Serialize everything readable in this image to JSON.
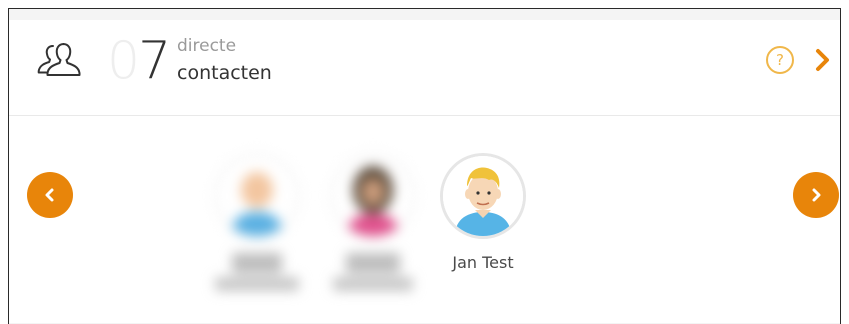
{
  "header": {
    "count_dim": "0",
    "count_main": "7",
    "label_line1": "directe",
    "label_line2": "contacten",
    "help_symbol": "?"
  },
  "colors": {
    "accent": "#e8850a",
    "help": "#f0b74a"
  },
  "icons": {
    "people": "people-icon",
    "help": "help-icon",
    "more": "chevron-right-icon",
    "prev": "chevron-left-icon",
    "next": "chevron-right-icon"
  },
  "contacts": [
    {
      "name_line1": "",
      "name_line2": ""
    },
    {
      "name_line1": "",
      "name_line2": ""
    },
    {
      "name": "Jan Test"
    }
  ]
}
